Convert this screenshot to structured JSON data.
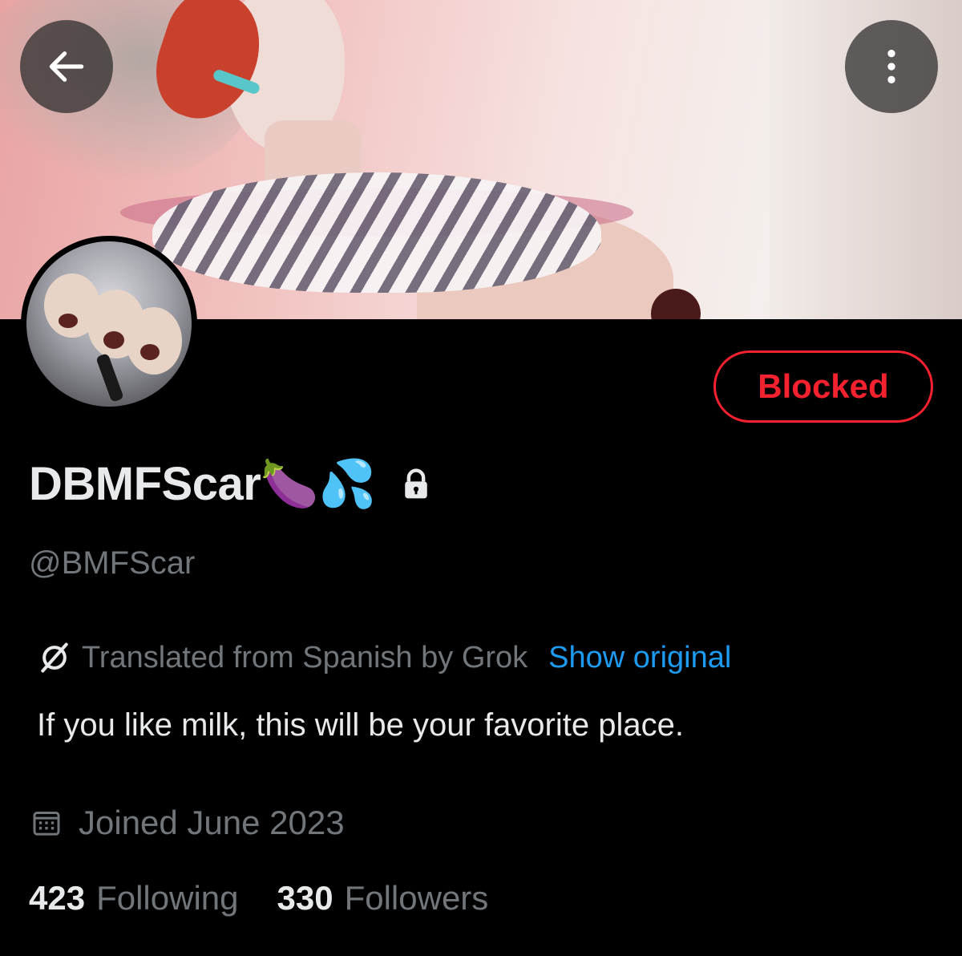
{
  "profile": {
    "display_name": "DBMFScar🍆💦",
    "handle": "@BMFScar",
    "action_button_label": "Blocked"
  },
  "translation": {
    "notice": "Translated from Spanish by Grok",
    "show_original_label": "Show original"
  },
  "bio": "If you like milk, this will be your favorite place.",
  "joined": "Joined June 2023",
  "stats": {
    "following_count": "423",
    "following_label": "Following",
    "followers_count": "330",
    "followers_label": "Followers"
  },
  "icons": {
    "back": "arrow-left-icon",
    "more": "more-vertical-icon",
    "lock": "lock-icon",
    "grok": "grok-icon",
    "calendar": "calendar-icon"
  },
  "colors": {
    "background": "#000000",
    "text_primary": "#e7e9ea",
    "text_secondary": "#71767b",
    "link": "#1d9bf0",
    "blocked": "#f4212e"
  }
}
